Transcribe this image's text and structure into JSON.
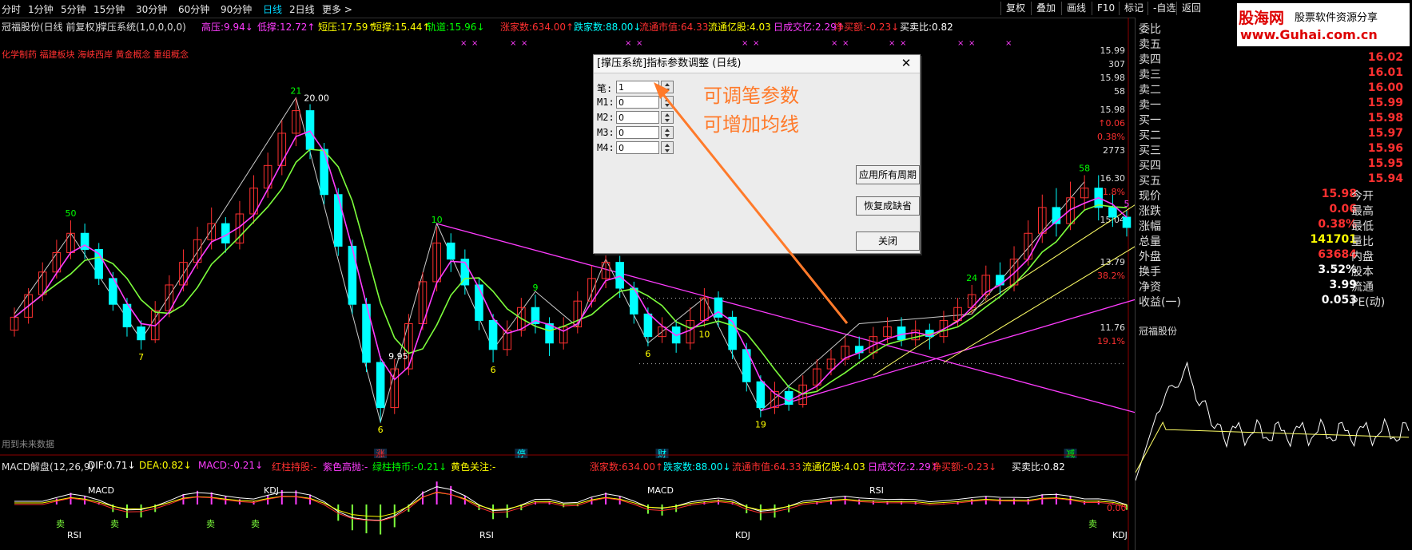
{
  "top_bar": {
    "periods": [
      "分时",
      "1分钟",
      "5分钟",
      "15分钟",
      "30分钟",
      "60分钟",
      "90分钟",
      "日线",
      "2日线",
      "更多 >"
    ],
    "active_period": "日线",
    "buttons": [
      "复权",
      "叠加",
      "画线",
      "F10",
      "标记",
      "-自选",
      "返回"
    ]
  },
  "info_bar": {
    "stock_name": "冠福股份(日线 前复权)",
    "indicator": "撑压系统(1,0,0,0,0)",
    "stats": [
      {
        "label": "高压:",
        "value": "9.94",
        "arrow": "↓",
        "color": "#ff3cff"
      },
      {
        "label": "低撑:",
        "value": "12.72",
        "arrow": "↑",
        "color": "#ff3cff"
      },
      {
        "label": "短压:",
        "value": "17.59",
        "arrow": "↑",
        "color": "#ffff00"
      },
      {
        "label": "短撑:",
        "value": "15.44",
        "arrow": "↑",
        "color": "#ffff00"
      },
      {
        "label": "轨道:",
        "value": "15.96",
        "arrow": "↓",
        "color": "#00ff00"
      },
      {
        "label": "涨家数:",
        "value": "634.00",
        "arrow": "↑",
        "color": "#ff3030"
      },
      {
        "label": "跌家数:",
        "value": "88.00",
        "arrow": "↓",
        "color": "#00ffff"
      },
      {
        "label": "流通市值:",
        "value": "64.33",
        "arrow": "",
        "color": "#ff3030"
      },
      {
        "label": "流通亿股:",
        "value": "4.03",
        "arrow": "",
        "color": "#ffff00"
      },
      {
        "label": "日成交亿:",
        "value": "2.29",
        "arrow": "↑",
        "color": "#ff3cff"
      },
      {
        "label": "净买额:",
        "value": "-0.23",
        "arrow": "↓",
        "color": "#ff3030"
      },
      {
        "label": "买卖比:",
        "value": "0.82",
        "arrow": "",
        "color": "#ffffff"
      }
    ],
    "concepts": "化学制药 福建板块 海峡西岸 黄金概念 重组概念",
    "future_note": "用到未来数据"
  },
  "chart_data": {
    "type": "candlestick",
    "title": "冠福股份(日线 前复权)",
    "price_axis_labels": [
      "15.99",
      "307",
      "15.98",
      "58",
      "15.98",
      "↑0.06",
      "0.38%",
      "2773",
      "16.30",
      "61.8%",
      "15.04",
      "13.79",
      "38.2%",
      "11.76",
      "19.1%"
    ],
    "price_range": [
      9.5,
      21.0
    ],
    "candles": [
      {
        "o": 12.8,
        "c": 13.2,
        "h": 13.5,
        "l": 12.6
      },
      {
        "o": 13.2,
        "c": 13.9,
        "h": 14.1,
        "l": 13.0
      },
      {
        "o": 13.9,
        "c": 14.6,
        "h": 14.9,
        "l": 13.7
      },
      {
        "o": 14.6,
        "c": 15.2,
        "h": 15.6,
        "l": 14.4
      },
      {
        "o": 15.2,
        "c": 15.8,
        "h": 16.2,
        "l": 15.0
      },
      {
        "o": 15.8,
        "c": 15.3,
        "h": 16.1,
        "l": 15.0
      },
      {
        "o": 15.3,
        "c": 14.4,
        "h": 15.5,
        "l": 14.2
      },
      {
        "o": 14.4,
        "c": 13.6,
        "h": 14.6,
        "l": 13.4
      },
      {
        "o": 13.6,
        "c": 12.9,
        "h": 13.8,
        "l": 12.6
      },
      {
        "o": 12.9,
        "c": 12.5,
        "h": 13.1,
        "l": 12.2
      },
      {
        "o": 12.5,
        "c": 13.4,
        "h": 13.7,
        "l": 12.4
      },
      {
        "o": 13.4,
        "c": 14.2,
        "h": 14.5,
        "l": 13.2
      },
      {
        "o": 14.2,
        "c": 14.9,
        "h": 15.3,
        "l": 14.0
      },
      {
        "o": 14.9,
        "c": 15.6,
        "h": 16.0,
        "l": 14.7
      },
      {
        "o": 15.6,
        "c": 16.1,
        "h": 16.6,
        "l": 15.3
      },
      {
        "o": 16.1,
        "c": 15.5,
        "h": 16.3,
        "l": 15.2
      },
      {
        "o": 15.5,
        "c": 16.4,
        "h": 16.8,
        "l": 15.3
      },
      {
        "o": 16.4,
        "c": 17.2,
        "h": 17.6,
        "l": 16.1
      },
      {
        "o": 17.2,
        "c": 17.9,
        "h": 18.3,
        "l": 16.9
      },
      {
        "o": 17.9,
        "c": 18.9,
        "h": 19.3,
        "l": 17.6
      },
      {
        "o": 18.9,
        "c": 19.6,
        "h": 20.0,
        "l": 18.5
      },
      {
        "o": 19.6,
        "c": 18.4,
        "h": 19.8,
        "l": 18.1
      },
      {
        "o": 18.4,
        "c": 17.0,
        "h": 18.6,
        "l": 16.7
      },
      {
        "o": 17.0,
        "c": 15.4,
        "h": 17.2,
        "l": 15.1
      },
      {
        "o": 15.4,
        "c": 13.6,
        "h": 15.6,
        "l": 13.3
      },
      {
        "o": 13.6,
        "c": 11.8,
        "h": 13.8,
        "l": 11.5
      },
      {
        "o": 11.8,
        "c": 10.4,
        "h": 12.0,
        "l": 9.95
      },
      {
        "o": 10.4,
        "c": 11.6,
        "h": 11.9,
        "l": 10.2
      },
      {
        "o": 11.6,
        "c": 13.0,
        "h": 13.3,
        "l": 11.4
      },
      {
        "o": 13.0,
        "c": 14.3,
        "h": 14.6,
        "l": 12.8
      },
      {
        "o": 14.3,
        "c": 15.5,
        "h": 16.0,
        "l": 14.0
      },
      {
        "o": 15.5,
        "c": 15.0,
        "h": 15.8,
        "l": 14.6
      },
      {
        "o": 15.0,
        "c": 14.2,
        "h": 15.3,
        "l": 13.9
      },
      {
        "o": 14.2,
        "c": 13.1,
        "h": 14.4,
        "l": 12.8
      },
      {
        "o": 13.1,
        "c": 12.2,
        "h": 13.3,
        "l": 11.8
      },
      {
        "o": 12.2,
        "c": 12.8,
        "h": 13.1,
        "l": 12.0
      },
      {
        "o": 12.8,
        "c": 13.5,
        "h": 13.8,
        "l": 12.6
      },
      {
        "o": 13.5,
        "c": 13.0,
        "h": 13.9,
        "l": 12.7
      },
      {
        "o": 13.0,
        "c": 12.4,
        "h": 13.2,
        "l": 12.0
      },
      {
        "o": 12.4,
        "c": 12.9,
        "h": 13.2,
        "l": 12.2
      },
      {
        "o": 12.9,
        "c": 13.7,
        "h": 14.0,
        "l": 12.7
      },
      {
        "o": 13.7,
        "c": 14.4,
        "h": 14.8,
        "l": 13.5
      },
      {
        "o": 14.4,
        "c": 14.9,
        "h": 15.2,
        "l": 14.1
      },
      {
        "o": 14.9,
        "c": 14.1,
        "h": 15.1,
        "l": 13.8
      },
      {
        "o": 14.1,
        "c": 13.3,
        "h": 14.3,
        "l": 13.0
      },
      {
        "o": 13.3,
        "c": 12.6,
        "h": 13.5,
        "l": 12.3
      },
      {
        "o": 12.6,
        "c": 12.9,
        "h": 13.2,
        "l": 12.4
      },
      {
        "o": 12.9,
        "c": 12.4,
        "h": 13.1,
        "l": 12.1
      },
      {
        "o": 12.4,
        "c": 13.1,
        "h": 13.5,
        "l": 12.2
      },
      {
        "o": 13.1,
        "c": 13.8,
        "h": 14.1,
        "l": 12.9
      },
      {
        "o": 13.8,
        "c": 13.2,
        "h": 14.0,
        "l": 12.9
      },
      {
        "o": 13.2,
        "c": 12.2,
        "h": 13.4,
        "l": 11.9
      },
      {
        "o": 12.2,
        "c": 11.2,
        "h": 12.4,
        "l": 10.9
      },
      {
        "o": 11.2,
        "c": 10.4,
        "h": 11.4,
        "l": 10.1
      },
      {
        "o": 10.4,
        "c": 10.9,
        "h": 11.2,
        "l": 10.2
      },
      {
        "o": 10.9,
        "c": 10.5,
        "h": 11.1,
        "l": 10.3
      },
      {
        "o": 10.5,
        "c": 11.1,
        "h": 11.4,
        "l": 10.4
      },
      {
        "o": 11.1,
        "c": 11.6,
        "h": 11.9,
        "l": 10.9
      },
      {
        "o": 11.6,
        "c": 11.9,
        "h": 12.2,
        "l": 11.4
      },
      {
        "o": 11.9,
        "c": 12.3,
        "h": 12.6,
        "l": 11.7
      },
      {
        "o": 12.3,
        "c": 12.1,
        "h": 12.6,
        "l": 11.9
      },
      {
        "o": 12.1,
        "c": 12.6,
        "h": 12.9,
        "l": 11.9
      },
      {
        "o": 12.6,
        "c": 12.9,
        "h": 13.2,
        "l": 12.4
      },
      {
        "o": 12.9,
        "c": 12.5,
        "h": 13.2,
        "l": 12.3
      },
      {
        "o": 12.5,
        "c": 12.8,
        "h": 13.1,
        "l": 12.3
      },
      {
        "o": 12.8,
        "c": 12.6,
        "h": 13.0,
        "l": 12.2
      },
      {
        "o": 12.6,
        "c": 13.1,
        "h": 13.4,
        "l": 12.4
      },
      {
        "o": 13.1,
        "c": 13.5,
        "h": 13.8,
        "l": 12.9
      },
      {
        "o": 13.5,
        "c": 13.9,
        "h": 14.2,
        "l": 13.3
      },
      {
        "o": 13.9,
        "c": 14.5,
        "h": 14.8,
        "l": 13.7
      },
      {
        "o": 14.5,
        "c": 14.2,
        "h": 14.9,
        "l": 13.9
      },
      {
        "o": 14.2,
        "c": 15.0,
        "h": 15.4,
        "l": 14.0
      },
      {
        "o": 15.0,
        "c": 15.8,
        "h": 16.2,
        "l": 14.8
      },
      {
        "o": 15.8,
        "c": 16.6,
        "h": 17.0,
        "l": 15.5
      },
      {
        "o": 16.6,
        "c": 16.1,
        "h": 17.2,
        "l": 15.7
      },
      {
        "o": 16.1,
        "c": 16.9,
        "h": 17.4,
        "l": 15.9
      },
      {
        "o": 16.9,
        "c": 17.2,
        "h": 17.6,
        "l": 16.5
      },
      {
        "o": 17.2,
        "c": 16.6,
        "h": 17.6,
        "l": 16.2
      },
      {
        "o": 16.6,
        "c": 16.3,
        "h": 17.0,
        "l": 16.0
      },
      {
        "o": 16.3,
        "c": 15.98,
        "h": 16.5,
        "l": 15.7
      }
    ],
    "point_labels": [
      {
        "i": 4,
        "text": "50",
        "color": "#00ff00",
        "pos": "above"
      },
      {
        "i": 9,
        "text": "7",
        "color": "#ffff00",
        "pos": "below"
      },
      {
        "i": 20,
        "text": "21",
        "color": "#00ff00",
        "pos": "above"
      },
      {
        "i": 20,
        "text": "20.00",
        "color": "#ffffff",
        "pos": "right"
      },
      {
        "i": 26,
        "text": "6",
        "color": "#ffff00",
        "pos": "below"
      },
      {
        "i": 26,
        "text": "9.95",
        "color": "#ffffff",
        "pos": "right"
      },
      {
        "i": 30,
        "text": "10",
        "color": "#00ff00",
        "pos": "above"
      },
      {
        "i": 34,
        "text": "6",
        "color": "#ffff00",
        "pos": "below"
      },
      {
        "i": 37,
        "text": "9",
        "color": "#00ff00",
        "pos": "above"
      },
      {
        "i": 42,
        "text": "4",
        "color": "#00ff00",
        "pos": "above"
      },
      {
        "i": 45,
        "text": "6",
        "color": "#ffff00",
        "pos": "below"
      },
      {
        "i": 49,
        "text": "10",
        "color": "#ffff00",
        "pos": "below"
      },
      {
        "i": 53,
        "text": "19",
        "color": "#ffff00",
        "pos": "below"
      },
      {
        "i": 68,
        "text": "24",
        "color": "#00ff00",
        "pos": "above"
      },
      {
        "i": 76,
        "text": "58",
        "color": "#00ff00",
        "pos": "above"
      },
      {
        "i": 79,
        "text": "5",
        "color": "#ff3cff",
        "pos": "above"
      }
    ],
    "bottom_markers": [
      {
        "i": 26,
        "text": "涨",
        "color": "#ff3030"
      },
      {
        "i": 36,
        "text": "停",
        "color": "#00ffff"
      },
      {
        "i": 46,
        "text": "财",
        "color": "#00ffff"
      },
      {
        "i": 75,
        "text": "减",
        "color": "#00ff00"
      }
    ]
  },
  "dialog": {
    "title": "[撑压系统]指标参数调整 (日线)",
    "params": [
      {
        "label": "笔:",
        "value": "1"
      },
      {
        "label": "M1:",
        "value": "0"
      },
      {
        "label": "M2:",
        "value": "0"
      },
      {
        "label": "M3:",
        "value": "0"
      },
      {
        "label": "M4:",
        "value": "0"
      }
    ],
    "buttons": [
      "应用所有周期",
      "恢复成缺省",
      "关闭"
    ],
    "close_glyph": "✕"
  },
  "annotations": {
    "line1": "可调笔参数",
    "line2": "可增加均线"
  },
  "macd_panel": {
    "header": [
      {
        "label": "MACD解盘(12,26,9)",
        "value": "",
        "color": "#dddddd"
      },
      {
        "label": "DIF:",
        "value": "0.71↓",
        "color": "#ffffff"
      },
      {
        "label": "DEA:",
        "value": "0.82↓",
        "color": "#ffff00"
      },
      {
        "label": "MACD:",
        "value": "-0.21↓",
        "color": "#ff3cff"
      },
      {
        "label": "红柱持股:",
        "value": "-",
        "color": "#ff3030"
      },
      {
        "label": "紫色高抛:",
        "value": "-",
        "color": "#ff3cff"
      },
      {
        "label": "绿柱持币:",
        "value": "-0.21↓",
        "color": "#00ff00"
      },
      {
        "label": "黄色关注:",
        "value": "-",
        "color": "#ffff00"
      },
      {
        "label": "涨家数:",
        "value": "634.00↑",
        "color": "#ff3030"
      },
      {
        "label": "跌家数:",
        "value": "88.00↓",
        "color": "#00ffff"
      },
      {
        "label": "流通市值:",
        "value": "64.33",
        "color": "#ff3030"
      },
      {
        "label": "流通亿股:",
        "value": "4.03",
        "color": "#ffff00"
      },
      {
        "label": "日成交亿:",
        "value": "2.29↑",
        "color": "#ff3cff"
      },
      {
        "label": "净买额:",
        "value": "-0.23↓",
        "color": "#ff3030"
      },
      {
        "label": "买卖比:",
        "value": "0.82",
        "color": "#ffffff"
      }
    ],
    "axis_label": "0.00",
    "signals": [
      "MACD",
      "RSI",
      "KDJ",
      "RSI",
      "MACD",
      "KDJ",
      "RSI",
      "KDJ",
      "卖",
      "卖",
      "卖",
      "卖",
      "卖"
    ]
  },
  "quote_panel": {
    "rows": [
      {
        "label": "委比",
        "value": "",
        "extra": "",
        "color": "#ffffff"
      },
      {
        "label": "卖五",
        "value": "16.03",
        "extra": "",
        "color": "#ff3030"
      },
      {
        "label": "卖四",
        "value": "16.02",
        "extra": "",
        "color": "#ff3030"
      },
      {
        "label": "卖三",
        "value": "16.01",
        "extra": "",
        "color": "#ff3030"
      },
      {
        "label": "卖二",
        "value": "16.00",
        "extra": "",
        "color": "#ff3030"
      },
      {
        "label": "卖一",
        "value": "15.99",
        "extra": "",
        "color": "#ff3030"
      },
      {
        "label": "买一",
        "value": "15.98",
        "extra": "",
        "color": "#ff3030"
      },
      {
        "label": "买二",
        "value": "15.97",
        "extra": "",
        "color": "#ff3030"
      },
      {
        "label": "买三",
        "value": "15.96",
        "extra": "",
        "color": "#ff3030"
      },
      {
        "label": "买四",
        "value": "15.95",
        "extra": "",
        "color": "#ff3030"
      },
      {
        "label": "买五",
        "value": "15.94",
        "extra": "",
        "color": "#ff3030"
      },
      {
        "label": "现价",
        "value": "15.98",
        "extra": "今开",
        "color": "#ff3030"
      },
      {
        "label": "涨跌",
        "value": "0.06",
        "extra": "最高",
        "color": "#ff3030"
      },
      {
        "label": "涨幅",
        "value": "0.38%",
        "extra": "最低",
        "color": "#ff3030"
      },
      {
        "label": "总量",
        "value": "141701",
        "extra": "量比",
        "color": "#ffff00"
      },
      {
        "label": "外盘",
        "value": "63684",
        "extra": "内盘",
        "color": "#ff3030"
      },
      {
        "label": "换手",
        "value": "3.52%",
        "extra": "股本",
        "color": "#ffffff"
      },
      {
        "label": "净资",
        "value": "3.99",
        "extra": "流通",
        "color": "#ffffff"
      },
      {
        "label": "收益(一)",
        "value": "0.053",
        "extra": "PE(动)",
        "color": "#ffffff"
      }
    ],
    "mini_title": "冠福股份"
  },
  "watermark": {
    "line1": "股海网",
    "line2": "股票软件资源分享",
    "line3": "www.Guhai.com.cn"
  },
  "colors": {
    "up": "#ff3030",
    "down": "#00ffff",
    "ma1": "#ff3cff",
    "ma2": "#7dff3c",
    "trend": "#ff3cff",
    "channel": "#ffff66"
  }
}
